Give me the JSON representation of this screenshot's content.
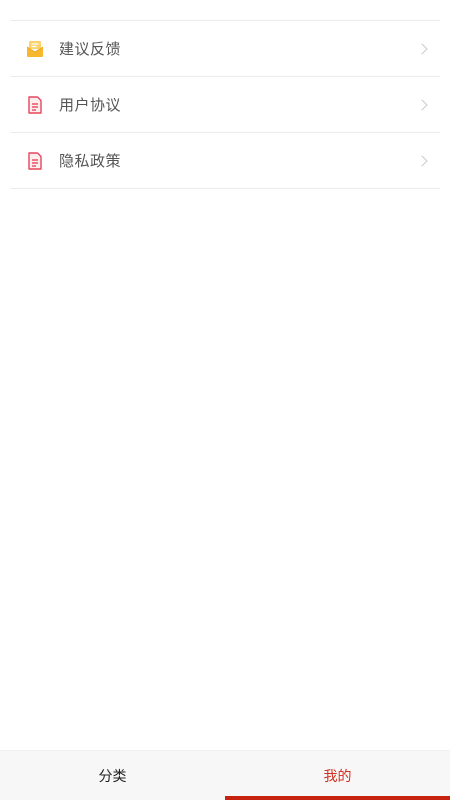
{
  "menu": {
    "items": [
      {
        "label": "建议反馈",
        "icon": "mail-icon",
        "icon_color": "#f7b82e"
      },
      {
        "label": "用户协议",
        "icon": "document-icon",
        "icon_color": "#e8455a"
      },
      {
        "label": "隐私政策",
        "icon": "document-icon",
        "icon_color": "#e8455a"
      }
    ]
  },
  "tabbar": {
    "tabs": [
      {
        "label": "分类",
        "active": false
      },
      {
        "label": "我的",
        "active": true
      }
    ],
    "active_color": "#d32f1f"
  }
}
